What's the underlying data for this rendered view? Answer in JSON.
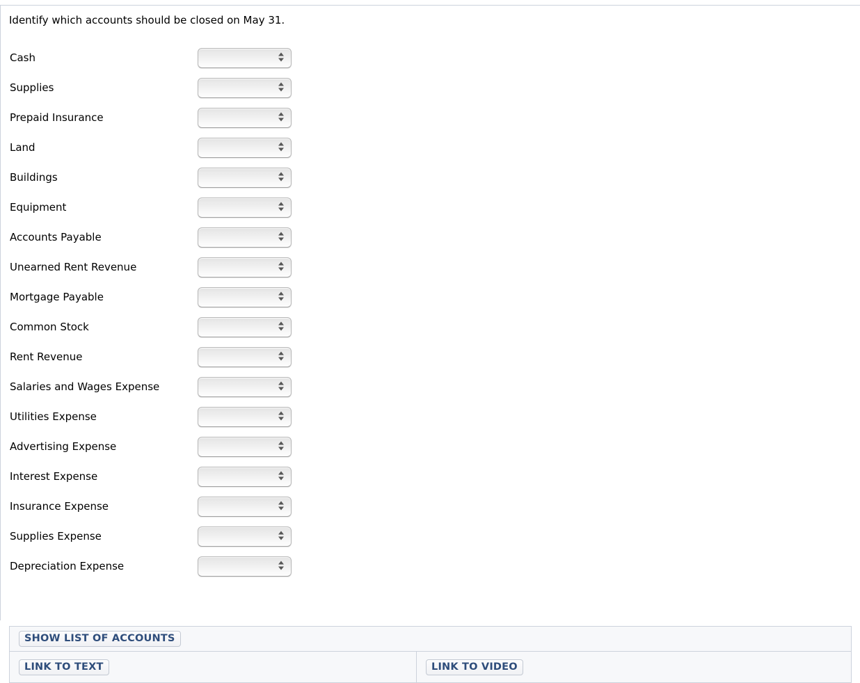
{
  "prompt": "Identify which accounts should be closed on May 31.",
  "accounts": [
    {
      "label": "Cash",
      "selected": ""
    },
    {
      "label": "Supplies",
      "selected": ""
    },
    {
      "label": "Prepaid Insurance",
      "selected": ""
    },
    {
      "label": "Land",
      "selected": ""
    },
    {
      "label": "Buildings",
      "selected": ""
    },
    {
      "label": "Equipment",
      "selected": ""
    },
    {
      "label": "Accounts Payable",
      "selected": ""
    },
    {
      "label": "Unearned Rent Revenue",
      "selected": ""
    },
    {
      "label": "Mortgage Payable",
      "selected": ""
    },
    {
      "label": "Common Stock",
      "selected": ""
    },
    {
      "label": "Rent Revenue",
      "selected": ""
    },
    {
      "label": "Salaries and Wages Expense",
      "selected": ""
    },
    {
      "label": "Utilities Expense",
      "selected": ""
    },
    {
      "label": "Advertising Expense",
      "selected": ""
    },
    {
      "label": "Interest Expense",
      "selected": ""
    },
    {
      "label": "Insurance Expense",
      "selected": ""
    },
    {
      "label": "Supplies Expense",
      "selected": ""
    },
    {
      "label": "Depreciation Expense",
      "selected": ""
    }
  ],
  "bottom": {
    "show_list_label": "SHOW LIST OF ACCOUNTS",
    "link_to_text_label": "LINK TO TEXT",
    "link_to_video_label": "LINK TO VIDEO"
  },
  "icons": {
    "stepper_up": "triangle-up-icon",
    "stepper_down": "triangle-down-icon"
  },
  "colors": {
    "link_text": "#2e4d7b",
    "panel_background": "#f7f8fa",
    "panel_border": "#ccd2dc",
    "select_border": "#b6b6b6",
    "stepper_arrow": "#565656",
    "body_text": "#000000"
  }
}
